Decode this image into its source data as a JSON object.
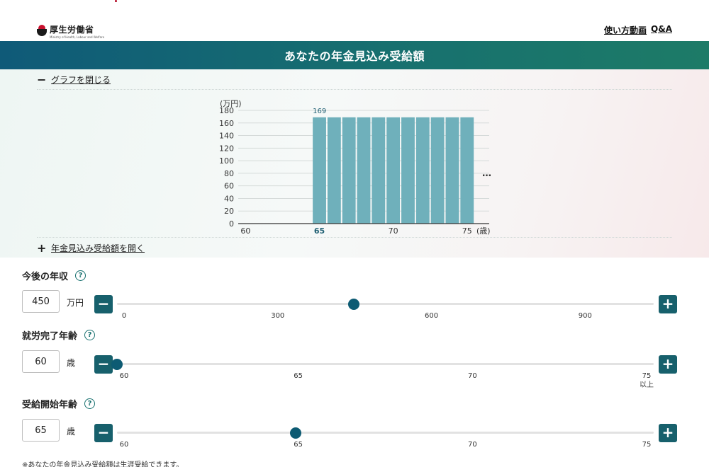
{
  "header": {
    "logo_text": "厚生労働省",
    "logo_subtext": "Ministry of Health, Labour and Welfare",
    "links": [
      "使い方動画",
      "Q&A"
    ],
    "title": "あなたの年金見込み受給額"
  },
  "chart_panel": {
    "close_label": "グラフを閉じる",
    "open_label": "年金見込み受給額を開く",
    "more_indicator": "…"
  },
  "chart_data": {
    "type": "bar",
    "ylabel": "(万円)",
    "xlabel": "(歳)",
    "ylim": [
      0,
      180
    ],
    "yticks": [
      0,
      20,
      40,
      60,
      80,
      100,
      120,
      140,
      160,
      180
    ],
    "xlim": [
      59.5,
      76.5
    ],
    "xticks": [
      60,
      65,
      70,
      75
    ],
    "highlight_tick": 65,
    "x": [
      60,
      61,
      62,
      63,
      64,
      65,
      66,
      67,
      68,
      69,
      70,
      71,
      72,
      73,
      74,
      75
    ],
    "values": [
      0,
      0,
      0,
      0,
      0,
      169,
      169,
      169,
      169,
      169,
      169,
      169,
      169,
      169,
      169,
      169
    ],
    "data_labels": [
      {
        "x": 65,
        "text": "169"
      }
    ],
    "bar_color": "#6fb0bb",
    "grid": true
  },
  "controls": [
    {
      "label": "今後の年収",
      "help": "?",
      "value": "450",
      "unit": "万円",
      "min": 0,
      "max": 1020,
      "current": 450,
      "ticks": [
        {
          "v": 0,
          "text": "0",
          "sub": ""
        },
        {
          "v": 300,
          "text": "300",
          "sub": ""
        },
        {
          "v": 600,
          "text": "600",
          "sub": ""
        },
        {
          "v": 900,
          "text": "900",
          "sub": ""
        }
      ]
    },
    {
      "label": "就労完了年齢",
      "help": "?",
      "value": "60",
      "unit": "歳",
      "min": 60,
      "max": 75,
      "current": 60,
      "ticks": [
        {
          "v": 60,
          "text": "60",
          "sub": ""
        },
        {
          "v": 65,
          "text": "65",
          "sub": ""
        },
        {
          "v": 70,
          "text": "70",
          "sub": ""
        },
        {
          "v": 75,
          "text": "75",
          "sub": "以上"
        }
      ]
    },
    {
      "label": "受給開始年齢",
      "help": "?",
      "value": "65",
      "unit": "歳",
      "min": 60,
      "max": 75,
      "current": 65,
      "ticks": [
        {
          "v": 60,
          "text": "60",
          "sub": ""
        },
        {
          "v": 65,
          "text": "65",
          "sub": ""
        },
        {
          "v": 70,
          "text": "70",
          "sub": ""
        },
        {
          "v": 75,
          "text": "75",
          "sub": ""
        }
      ]
    }
  ],
  "buttons": {
    "minus": "−",
    "plus": "+"
  },
  "footnote": "※あなたの年金見込み受給額は生涯受給できます。",
  "colors": {
    "accent": "#17606c",
    "title_bar": "#17706f"
  }
}
